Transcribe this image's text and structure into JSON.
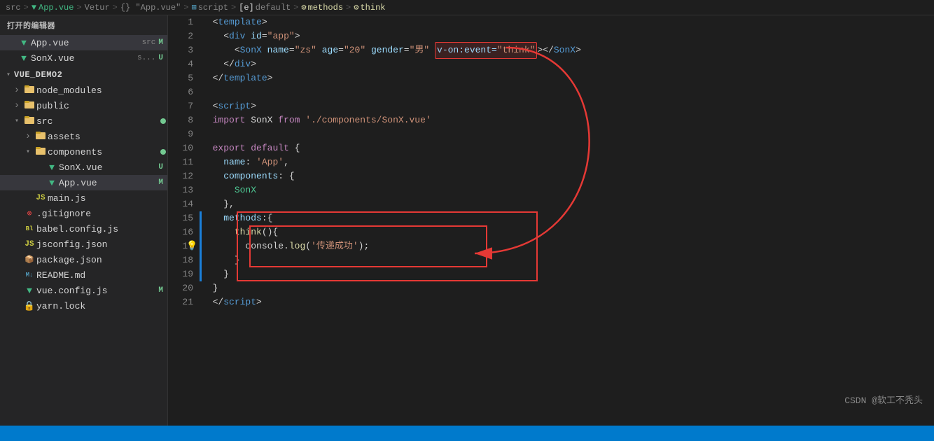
{
  "breadcrumb": {
    "parts": [
      {
        "label": "src",
        "type": "folder"
      },
      {
        "label": ">",
        "type": "sep"
      },
      {
        "label": "App.vue",
        "type": "vue"
      },
      {
        "label": ">",
        "type": "sep"
      },
      {
        "label": "Vetur",
        "type": "text"
      },
      {
        "label": ">",
        "type": "sep"
      },
      {
        "label": "{} \"App.vue\"",
        "type": "text"
      },
      {
        "label": ">",
        "type": "sep"
      },
      {
        "label": "script",
        "type": "text"
      },
      {
        "label": ">",
        "type": "sep"
      },
      {
        "label": "[e] default",
        "type": "text"
      },
      {
        "label": ">",
        "type": "sep"
      },
      {
        "label": "methods",
        "type": "text"
      },
      {
        "label": ">",
        "type": "sep"
      },
      {
        "label": "think",
        "type": "method"
      }
    ]
  },
  "sidebar": {
    "header": "打开的编辑器",
    "open_files": [
      {
        "name": "App.vue",
        "path": "src",
        "badge": "M",
        "active": false
      },
      {
        "name": "SonX.vue",
        "path": "s...",
        "badge": "U",
        "active": false
      }
    ],
    "tree": {
      "root": "VUE_DEMO2",
      "items": [
        {
          "label": "node_modules",
          "type": "folder",
          "depth": 1,
          "open": false
        },
        {
          "label": "public",
          "type": "folder",
          "depth": 1,
          "open": false
        },
        {
          "label": "src",
          "type": "folder",
          "depth": 1,
          "open": true,
          "dot": true
        },
        {
          "label": "assets",
          "type": "folder",
          "depth": 2,
          "open": false
        },
        {
          "label": "components",
          "type": "folder",
          "depth": 2,
          "open": true,
          "dot": true
        },
        {
          "label": "SonX.vue",
          "type": "vue",
          "depth": 3,
          "badge": "U"
        },
        {
          "label": "App.vue",
          "type": "vue",
          "depth": 3,
          "badge": "M",
          "active": true
        },
        {
          "label": "main.js",
          "type": "js",
          "depth": 2
        },
        {
          "label": ".gitignore",
          "type": "git",
          "depth": 1
        },
        {
          "label": "babel.config.js",
          "type": "babel",
          "depth": 1
        },
        {
          "label": "jsconfig.json",
          "type": "json",
          "depth": 1
        },
        {
          "label": "package.json",
          "type": "json",
          "depth": 1
        },
        {
          "label": "README.md",
          "type": "md",
          "depth": 1
        },
        {
          "label": "vue.config.js",
          "type": "vue",
          "depth": 1,
          "badge": "M"
        },
        {
          "label": "yarn.lock",
          "type": "yarn",
          "depth": 1
        }
      ]
    }
  },
  "editor": {
    "lines": [
      {
        "num": 1,
        "tokens": [
          {
            "t": "  ",
            "c": ""
          },
          {
            "t": "<",
            "c": "s-punct"
          },
          {
            "t": "template",
            "c": "s-tag"
          },
          {
            "t": ">",
            "c": "s-punct"
          }
        ]
      },
      {
        "num": 2,
        "tokens": [
          {
            "t": "    ",
            "c": ""
          },
          {
            "t": "<",
            "c": "s-punct"
          },
          {
            "t": "div",
            "c": "s-tag"
          },
          {
            "t": " ",
            "c": ""
          },
          {
            "t": "id",
            "c": "s-attr"
          },
          {
            "t": "=",
            "c": "s-punct"
          },
          {
            "t": "\"app\"",
            "c": "s-val"
          },
          {
            "t": ">",
            "c": "s-punct"
          }
        ]
      },
      {
        "num": 3,
        "tokens": [
          {
            "t": "      ",
            "c": ""
          },
          {
            "t": "<",
            "c": "s-punct"
          },
          {
            "t": "SonX",
            "c": "s-tag"
          },
          {
            "t": " ",
            "c": ""
          },
          {
            "t": "name",
            "c": "s-attr"
          },
          {
            "t": "=",
            "c": "s-punct"
          },
          {
            "t": "\"zs\"",
            "c": "s-val"
          },
          {
            "t": " ",
            "c": ""
          },
          {
            "t": "age",
            "c": "s-attr"
          },
          {
            "t": "=",
            "c": "s-punct"
          },
          {
            "t": "\"20\"",
            "c": "s-val"
          },
          {
            "t": " ",
            "c": ""
          },
          {
            "t": "gender",
            "c": "s-attr"
          },
          {
            "t": "=",
            "c": "s-punct"
          },
          {
            "t": "\"男\"",
            "c": "s-val"
          },
          {
            "t": " ",
            "c": ""
          },
          {
            "t": "v-on:event",
            "c": "s-vuebind",
            "box": "red-top"
          },
          {
            "t": "=",
            "c": "s-punct",
            "box": "red-top"
          },
          {
            "t": "\"think\"",
            "c": "s-val",
            "box": "red-top"
          },
          {
            "t": ">",
            "c": "s-punct"
          },
          {
            "t": "</",
            "c": "s-punct"
          },
          {
            "t": "SonX",
            "c": "s-tag"
          },
          {
            "t": ">",
            "c": "s-punct"
          }
        ]
      },
      {
        "num": 4,
        "tokens": [
          {
            "t": "    ",
            "c": ""
          },
          {
            "t": "</",
            "c": "s-punct"
          },
          {
            "t": "div",
            "c": "s-tag"
          },
          {
            "t": ">",
            "c": "s-punct"
          }
        ]
      },
      {
        "num": 5,
        "tokens": [
          {
            "t": "  ",
            "c": ""
          },
          {
            "t": "</",
            "c": "s-punct"
          },
          {
            "t": "template",
            "c": "s-tag"
          },
          {
            "t": ">",
            "c": "s-punct"
          }
        ]
      },
      {
        "num": 6,
        "tokens": []
      },
      {
        "num": 7,
        "tokens": [
          {
            "t": "  ",
            "c": ""
          },
          {
            "t": "<",
            "c": "s-punct"
          },
          {
            "t": "script",
            "c": "s-tag"
          },
          {
            "t": ">",
            "c": "s-punct"
          }
        ]
      },
      {
        "num": 8,
        "tokens": [
          {
            "t": "  ",
            "c": ""
          },
          {
            "t": "import",
            "c": "s-import"
          },
          {
            "t": " SonX ",
            "c": "s-text"
          },
          {
            "t": "from",
            "c": "s-from"
          },
          {
            "t": " ",
            "c": ""
          },
          {
            "t": "'./components/SonX.vue'",
            "c": "s-string"
          }
        ]
      },
      {
        "num": 9,
        "tokens": []
      },
      {
        "num": 10,
        "tokens": [
          {
            "t": "  ",
            "c": ""
          },
          {
            "t": "export",
            "c": "s-keyword"
          },
          {
            "t": " ",
            "c": ""
          },
          {
            "t": "default",
            "c": "s-keyword"
          },
          {
            "t": " {",
            "c": "s-text"
          }
        ]
      },
      {
        "num": 11,
        "tokens": [
          {
            "t": "    ",
            "c": ""
          },
          {
            "t": "name",
            "c": "s-prop"
          },
          {
            "t": ": ",
            "c": "s-text"
          },
          {
            "t": "'App'",
            "c": "s-string"
          },
          {
            "t": ",",
            "c": "s-text"
          }
        ]
      },
      {
        "num": 12,
        "tokens": [
          {
            "t": "    ",
            "c": ""
          },
          {
            "t": "components",
            "c": "s-prop"
          },
          {
            "t": ": {",
            "c": "s-text"
          }
        ]
      },
      {
        "num": 13,
        "tokens": [
          {
            "t": "      ",
            "c": ""
          },
          {
            "t": "SonX",
            "c": "s-green"
          }
        ]
      },
      {
        "num": 14,
        "tokens": [
          {
            "t": "    ",
            "c": ""
          },
          {
            "t": "},",
            "c": "s-text"
          }
        ]
      },
      {
        "num": 15,
        "tokens": [
          {
            "t": "    ",
            "c": ""
          },
          {
            "t": "methods",
            "c": "s-prop"
          },
          {
            "t": ":{",
            "c": "s-text"
          }
        ],
        "hasLeftBorder": true
      },
      {
        "num": 16,
        "tokens": [
          {
            "t": "      ",
            "c": ""
          },
          {
            "t": "think",
            "c": "s-yellow"
          },
          {
            "t": "(){",
            "c": "s-text"
          }
        ],
        "hasLeftBorder": true
      },
      {
        "num": 17,
        "tokens": [
          {
            "t": "        ",
            "c": ""
          },
          {
            "t": "console",
            "c": "s-text"
          },
          {
            "t": ".",
            "c": "s-text"
          },
          {
            "t": "log",
            "c": "s-yellow"
          },
          {
            "t": "(",
            "c": "s-text"
          },
          {
            "t": "'传递成功'",
            "c": "s-string"
          },
          {
            "t": ");",
            "c": "s-text"
          }
        ],
        "hasLeftBorder": true,
        "hasBulb": true
      },
      {
        "num": 18,
        "tokens": [
          {
            "t": "      ",
            "c": ""
          },
          {
            "t": "}",
            "c": "s-text"
          }
        ],
        "hasLeftBorder": true
      },
      {
        "num": 19,
        "tokens": [
          {
            "t": "    ",
            "c": ""
          },
          {
            "t": "}",
            "c": "s-text"
          }
        ],
        "hasLeftBorder": true
      },
      {
        "num": 20,
        "tokens": [
          {
            "t": "  ",
            "c": ""
          },
          {
            "t": "}",
            "c": "s-text"
          }
        ]
      },
      {
        "num": 21,
        "tokens": [
          {
            "t": "  ",
            "c": ""
          },
          {
            "t": "</",
            "c": "s-punct"
          },
          {
            "t": "script",
            "c": "s-tag"
          },
          {
            "t": ">",
            "c": "s-punct"
          }
        ]
      }
    ]
  },
  "watermark": "CSDN @软工不秃头",
  "status_bar": {}
}
